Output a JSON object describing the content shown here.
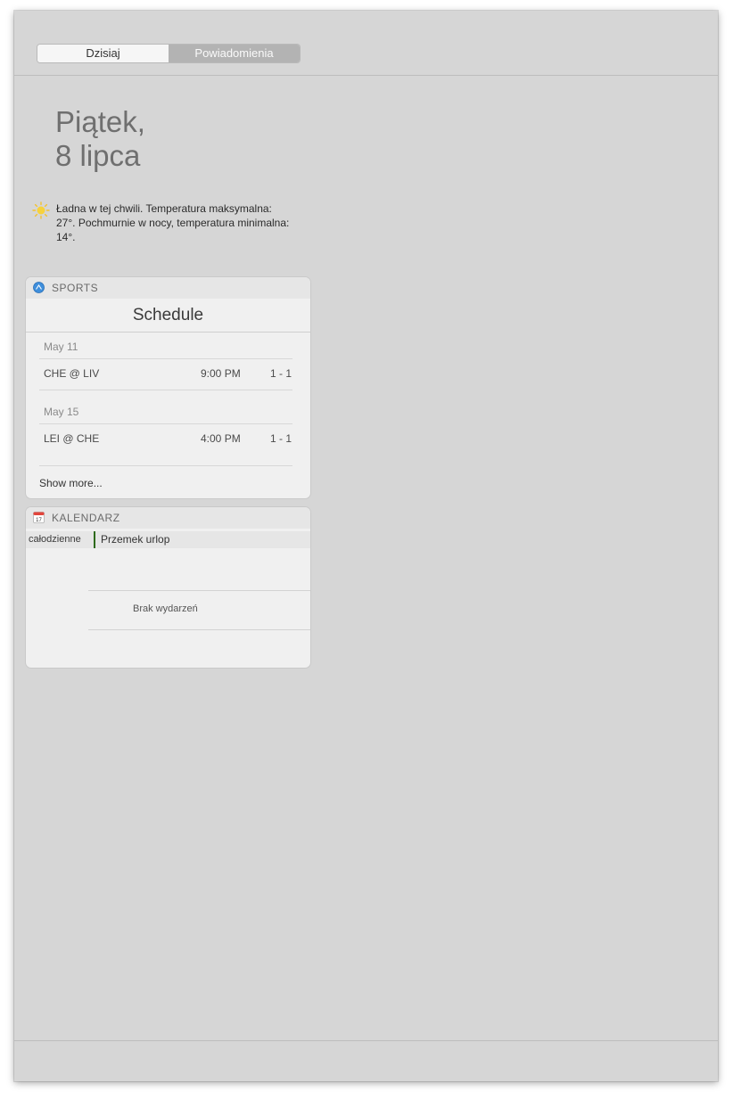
{
  "segmented": {
    "today_label": "Dzisiaj",
    "notifications_label": "Powiadomienia"
  },
  "date": {
    "line1": "Piątek,",
    "line2": "8 lipca"
  },
  "weather": {
    "icon": "sun-icon",
    "text": "Ładna w tej chwili. Temperatura maksymalna: 27°. Pochmurnie w nocy, temperatura minimalna: 14°."
  },
  "sports": {
    "header": "SPORTS",
    "icon": "sports-app-icon",
    "title": "Schedule",
    "groups": [
      {
        "date": "May 11",
        "games": [
          {
            "teams": "CHE @ LIV",
            "time": "9:00 PM",
            "score": "1 - 1"
          }
        ]
      },
      {
        "date": "May 15",
        "games": [
          {
            "teams": "LEI @ CHE",
            "time": "4:00 PM",
            "score": "1 - 1"
          }
        ]
      }
    ],
    "show_more": "Show more..."
  },
  "calendar": {
    "header": "KALENDARZ",
    "icon": "calendar-app-icon",
    "all_day_label": "całodzienne",
    "all_day_event": "Przemek urlop",
    "event_color": "#2e6a1c",
    "empty_text": "Brak wydarzeń"
  },
  "colors": {
    "panel_bg": "#d6d6d6",
    "widget_bg": "#f0f0f0",
    "widget_header_bg": "#e6e6e6"
  }
}
